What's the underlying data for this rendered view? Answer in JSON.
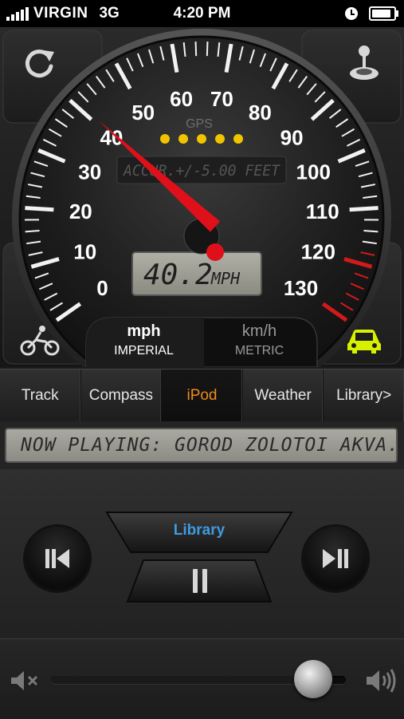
{
  "status_bar": {
    "carrier": "VIRGIN",
    "network": "3G",
    "time": "4:20 PM",
    "battery_level": 0.9
  },
  "gauge": {
    "gps_label": "GPS",
    "gps_dots": 5,
    "accuracy_text": "ACCUR.+/-5.00 FEET",
    "speed_readout": "40.2",
    "speed_unit": "MPH",
    "speed_value": 40.2,
    "scale_max": 130,
    "scale_labels": [
      "0",
      "10",
      "20",
      "30",
      "40",
      "50",
      "60",
      "70",
      "80",
      "90",
      "100",
      "110",
      "120",
      "130"
    ],
    "needle_color": "#e0101a",
    "redline_color": "#d21a1a",
    "corner_icons": {
      "top_left": "refresh-icon",
      "top_right": "joystick-icon",
      "bottom_left": "bicycle-icon",
      "bottom_right": "car-icon"
    },
    "car_icon_color": "#d6f000"
  },
  "units": {
    "imperial_unit": "mph",
    "imperial_label": "IMPERIAL",
    "metric_unit": "km/h",
    "metric_label": "METRIC"
  },
  "tabs": [
    {
      "label": "Track",
      "active": false
    },
    {
      "label": "Compass",
      "active": false
    },
    {
      "label": "iPod",
      "active": true
    },
    {
      "label": "Weather",
      "active": false
    },
    {
      "label": "Library>",
      "active": false
    }
  ],
  "tab_active_color": "#f08a1c",
  "now_playing": "NOW PLAYING: GOROD ZOLOTOI AKVA...",
  "player": {
    "library_label": "Library",
    "library_color": "#3f9be0",
    "prev_icon": "previous-track-icon",
    "pause_icon": "pause-icon",
    "next_icon": "play-pause-icon"
  },
  "volume": {
    "level": 0.89,
    "mute_icon": "mute-icon",
    "max_icon": "volume-max-icon"
  }
}
